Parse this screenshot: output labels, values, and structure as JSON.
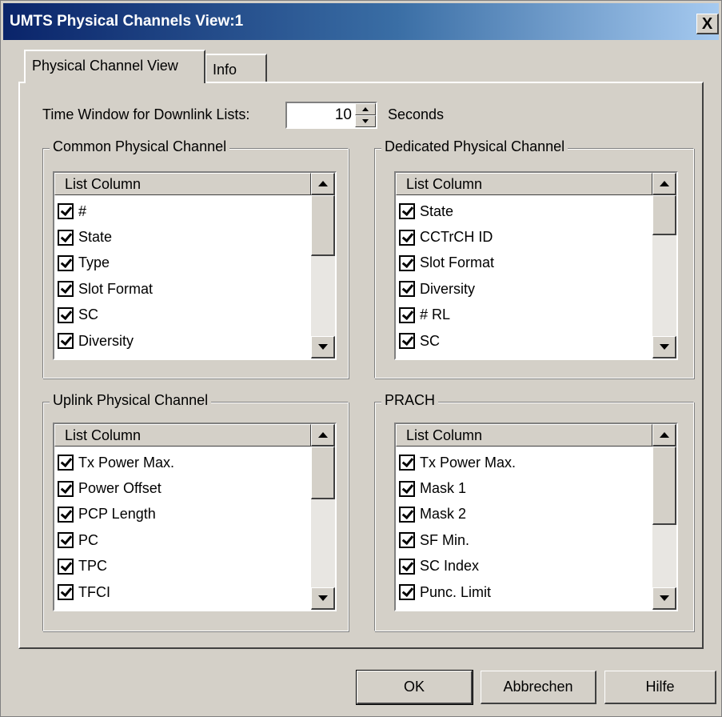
{
  "window": {
    "title": "UMTS Physical Channels View:1",
    "close_glyph": "X"
  },
  "tabs": [
    {
      "label": "Physical Channel View",
      "selected": true
    },
    {
      "label": "Info",
      "selected": false
    }
  ],
  "time_window": {
    "label": "Time Window for Downlink Lists:",
    "value": "10",
    "unit": "Seconds"
  },
  "groups": {
    "common": {
      "title": "Common Physical Channel",
      "list_header": "List Column",
      "items": [
        {
          "label": "#",
          "checked": true
        },
        {
          "label": "State",
          "checked": true
        },
        {
          "label": "Type",
          "checked": true
        },
        {
          "label": "Slot Format",
          "checked": true
        },
        {
          "label": "SC",
          "checked": true
        },
        {
          "label": "Diversity",
          "checked": true
        }
      ]
    },
    "dedicated": {
      "title": "Dedicated Physical Channel",
      "list_header": "List Column",
      "items": [
        {
          "label": "State",
          "checked": true
        },
        {
          "label": "CCTrCH ID",
          "checked": true
        },
        {
          "label": "Slot Format",
          "checked": true
        },
        {
          "label": "Diversity",
          "checked": true
        },
        {
          "label": "# RL",
          "checked": true
        },
        {
          "label": "SC",
          "checked": true
        }
      ]
    },
    "uplink": {
      "title": "Uplink Physical Channel",
      "list_header": "List Column",
      "items": [
        {
          "label": "Tx Power Max.",
          "checked": true
        },
        {
          "label": "Power Offset",
          "checked": true
        },
        {
          "label": "PCP Length",
          "checked": true
        },
        {
          "label": "PC",
          "checked": true
        },
        {
          "label": "TPC",
          "checked": true
        },
        {
          "label": "TFCI",
          "checked": true
        }
      ]
    },
    "prach": {
      "title": "PRACH",
      "list_header": "List Column",
      "items": [
        {
          "label": "Tx Power Max.",
          "checked": true
        },
        {
          "label": "Mask 1",
          "checked": true
        },
        {
          "label": "Mask 2",
          "checked": true
        },
        {
          "label": "SF Min.",
          "checked": true
        },
        {
          "label": "SC Index",
          "checked": true
        },
        {
          "label": "Punc. Limit",
          "checked": true
        }
      ]
    }
  },
  "buttons": {
    "ok": "OK",
    "cancel": "Abbrechen",
    "help": "Hilfe"
  },
  "colors": {
    "titlebar_start": "#0a246a",
    "titlebar_end": "#a6caf0",
    "face": "#d4d0c8"
  }
}
